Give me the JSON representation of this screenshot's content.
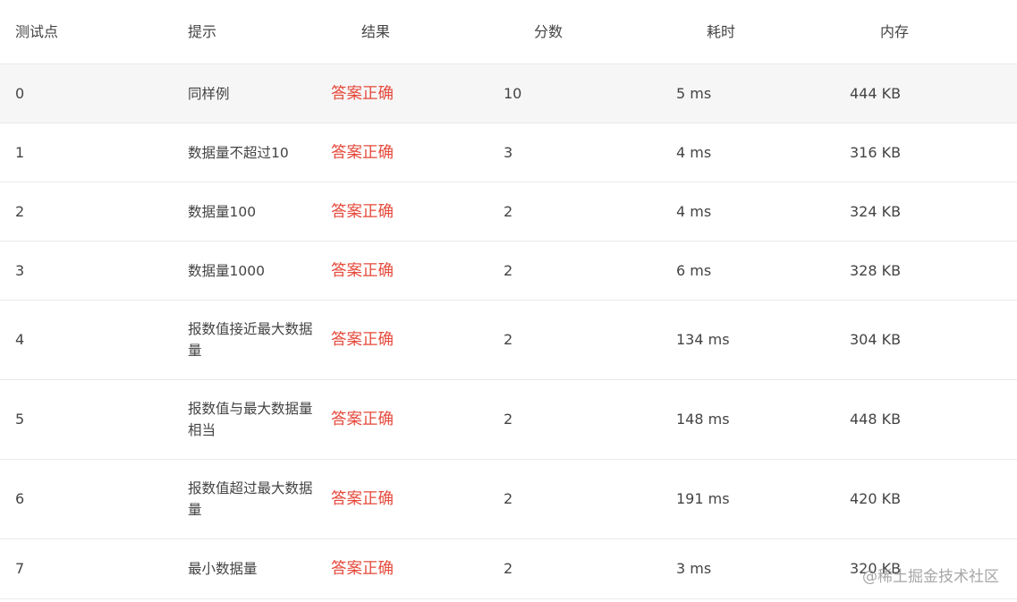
{
  "header": {
    "test_point": "测试点",
    "hint": "提示",
    "result": "结果",
    "score": "分数",
    "time": "耗时",
    "memory": "内存"
  },
  "rows": [
    {
      "id": "0",
      "hint": "同样例",
      "result": "答案正确",
      "score": "10",
      "time": "5 ms",
      "memory": "444 KB"
    },
    {
      "id": "1",
      "hint": "数据量不超过10",
      "result": "答案正确",
      "score": "3",
      "time": "4 ms",
      "memory": "316 KB"
    },
    {
      "id": "2",
      "hint": "数据量100",
      "result": "答案正确",
      "score": "2",
      "time": "4 ms",
      "memory": "324 KB"
    },
    {
      "id": "3",
      "hint": "数据量1000",
      "result": "答案正确",
      "score": "2",
      "time": "6 ms",
      "memory": "328 KB"
    },
    {
      "id": "4",
      "hint": "报数值接近最大数据量",
      "result": "答案正确",
      "score": "2",
      "time": "134 ms",
      "memory": "304 KB"
    },
    {
      "id": "5",
      "hint": "报数值与最大数据量相当",
      "result": "答案正确",
      "score": "2",
      "time": "148 ms",
      "memory": "448 KB"
    },
    {
      "id": "6",
      "hint": "报数值超过最大数据量",
      "result": "答案正确",
      "score": "2",
      "time": "191 ms",
      "memory": "420 KB"
    },
    {
      "id": "7",
      "hint": "最小数据量",
      "result": "答案正确",
      "score": "2",
      "time": "3 ms",
      "memory": "320 KB"
    }
  ],
  "watermark": "@稀土掘金技术社区",
  "colors": {
    "result_accepted": "#e5483a",
    "header_text": "#6b6b6b",
    "row_highlight_bg": "#f6f6f6",
    "border": "#e9e9e9"
  }
}
